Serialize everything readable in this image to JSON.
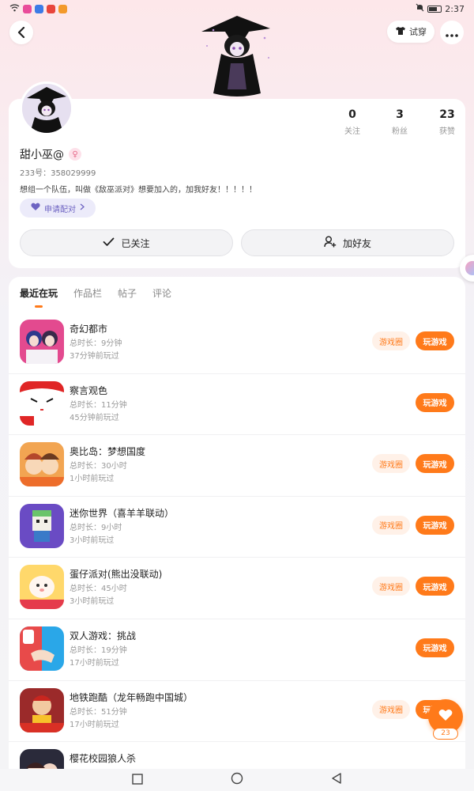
{
  "status_bar": {
    "time": "2:37"
  },
  "header": {
    "try_on_label": "试穿"
  },
  "profile": {
    "stats": [
      {
        "value": "0",
        "label": "关注"
      },
      {
        "value": "3",
        "label": "粉丝"
      },
      {
        "value": "23",
        "label": "获赞"
      }
    ],
    "nickname": "甜小巫@",
    "user_id": "233号：358029999",
    "bio": "想组一个队伍，叫做《敌巫派对》想要加入的，加我好友！！！！！",
    "pair_label": "申请配对",
    "follow_label": "已关注",
    "add_friend_label": "加好友"
  },
  "tabs": [
    "最近在玩",
    "作品栏",
    "帖子",
    "评论"
  ],
  "games": [
    {
      "name": "奇幻都市",
      "duration": "总时长：9分钟",
      "last_played": "37分钟前玩过",
      "circle_label": "游戏圈",
      "play_label": "玩游戏"
    },
    {
      "name": "察言观色",
      "duration": "总时长：11分钟",
      "last_played": "45分钟前玩过",
      "circle_label": "",
      "play_label": "玩游戏"
    },
    {
      "name": "奥比岛：梦想国度",
      "duration": "总时长：30小时",
      "last_played": "1小时前玩过",
      "circle_label": "游戏圈",
      "play_label": "玩游戏"
    },
    {
      "name": "迷你世界（喜羊羊联动）",
      "duration": "总时长：9小时",
      "last_played": "3小时前玩过",
      "circle_label": "游戏圈",
      "play_label": "玩游戏"
    },
    {
      "name": "蛋仔派对(熊出没联动)",
      "duration": "总时长：45小时",
      "last_played": "3小时前玩过",
      "circle_label": "游戏圈",
      "play_label": "玩游戏"
    },
    {
      "name": "双人游戏：挑战",
      "duration": "总时长：19分钟",
      "last_played": "17小时前玩过",
      "circle_label": "",
      "play_label": "玩游戏"
    },
    {
      "name": "地铁跑酷（龙年畅跑中国城）",
      "duration": "总时长：51分钟",
      "last_played": "17小时前玩过",
      "circle_label": "游戏圈",
      "play_label": "玩游戏"
    },
    {
      "name": "樱花校园狼人杀",
      "duration": "",
      "last_played": "",
      "circle_label": "",
      "play_label": ""
    }
  ],
  "like": {
    "count": "23"
  },
  "colors": {
    "accent": "#ff7a1a",
    "pair": "#6d63c2"
  }
}
